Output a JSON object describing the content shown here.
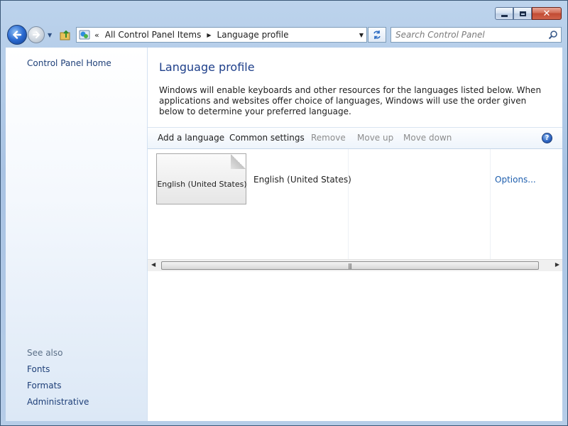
{
  "navigation": {
    "breadcrumb": [
      "All Control Panel Items",
      "Language profile"
    ],
    "search_placeholder": "Search Control Panel"
  },
  "sidebar": {
    "home_link": "Control Panel Home",
    "see_also_label": "See also",
    "see_also_links": [
      "Fonts",
      "Formats",
      "Administrative"
    ]
  },
  "main": {
    "title": "Language profile",
    "description": "Windows will enable keyboards and other resources for the languages listed below. When applications and websites offer choice of languages, Windows will use the order given below to determine your preferred language.",
    "toolbar": {
      "add_language": "Add a language",
      "common_settings": "Common settings",
      "remove": "Remove",
      "move_up": "Move up",
      "move_down": "Move down"
    },
    "languages": [
      {
        "tile_label": "English (United States)",
        "name": "English (United States)",
        "options_link": "Options..."
      }
    ]
  },
  "icons": {
    "back": "back-arrow-icon",
    "forward": "forward-arrow-icon",
    "refresh": "refresh-icon",
    "search": "search-icon",
    "help": "help-icon"
  }
}
